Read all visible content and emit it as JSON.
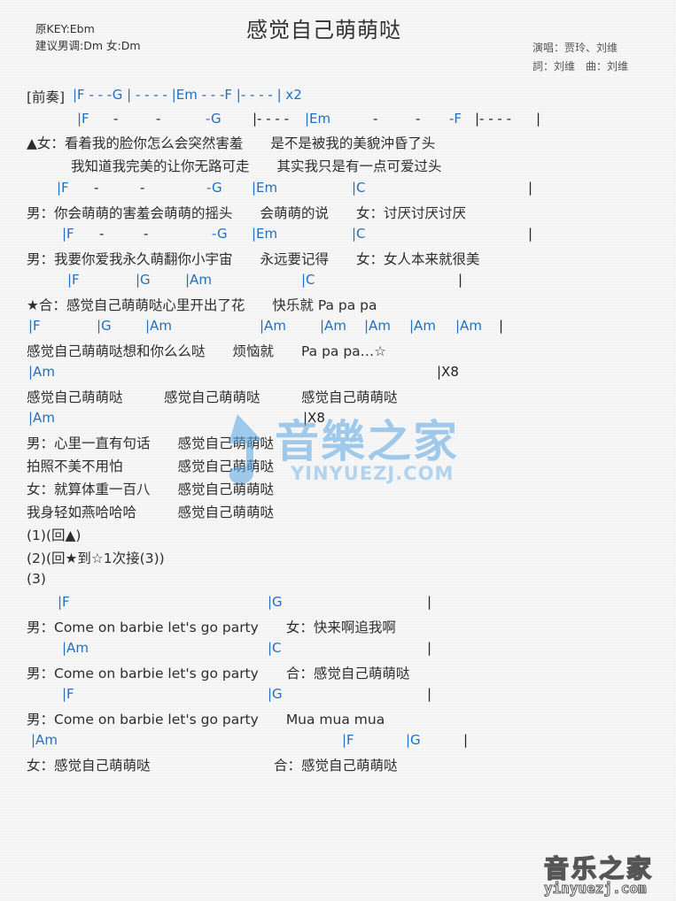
{
  "header": {
    "key": "原KEY:Ebm",
    "suggest": "建议男调:Dm 女:Dm",
    "title": "感觉自己萌萌哒",
    "singers": "演唱：贾玲、刘维",
    "credits": "詞：刘维　曲：刘维"
  },
  "intro": {
    "label": "[前奏]",
    "row1": "|F - -  -G | - - - - |Em - -  -F |- - - - | x2",
    "row2": [
      {
        "t": "|F",
        "c": 1
      },
      {
        "t": "-",
        "c": 0
      },
      {
        "t": "-",
        "c": 0
      },
      {
        "t": "-G",
        "c": 1
      },
      {
        "t": "|- - - -",
        "c": 0
      },
      {
        "t": "|Em",
        "c": 1
      },
      {
        "t": "-",
        "c": 0
      },
      {
        "t": "-",
        "c": 0
      },
      {
        "t": "-F",
        "c": 1
      },
      {
        "t": "|- - - -",
        "c": 0
      },
      {
        "t": "|",
        "c": 0
      }
    ]
  },
  "lines": [
    {
      "type": "lyric",
      "text": "▲女：看着我的脸你怎么会突然害羞　　是不是被我的美貌沖昏了头"
    },
    {
      "type": "lyric",
      "text": "我知道我完美的让你无路可走　　其实我只是有一点可爱过头"
    },
    {
      "type": "chord",
      "items": [
        "|F",
        "-",
        "-",
        "-G",
        "|Em",
        "|C",
        "|"
      ]
    },
    {
      "type": "lyric",
      "text": "男：你会萌萌的害羞会萌萌的摇头　　会萌萌的说　　女：讨厌讨厌讨厌"
    },
    {
      "type": "chord",
      "items": [
        "|F",
        "-",
        "-",
        "-G",
        "|Em",
        "|C",
        "|"
      ]
    },
    {
      "type": "lyric",
      "text": "男：我要你爱我永久萌翻你小宇宙　　永远要记得　　女：女人本来就很美"
    },
    {
      "type": "chord",
      "items": [
        "|F",
        "|G",
        "|Am",
        "|C",
        "|"
      ]
    },
    {
      "type": "lyric",
      "text": "★合：感觉自己萌萌哒心里开出了花　　快乐就  Pa pa pa"
    },
    {
      "type": "chord",
      "items": [
        "|F",
        "|G",
        "|Am",
        "|Am",
        "|Am",
        "|Am",
        "|Am",
        "|Am",
        "|"
      ]
    },
    {
      "type": "lyric",
      "text": "感觉自己萌萌哒想和你么么哒　　烦恼就　　Pa pa pa…☆"
    },
    {
      "type": "chord",
      "items": [
        "|Am",
        "|X8"
      ]
    },
    {
      "type": "lyric",
      "text": "感觉自己萌萌哒　　　感觉自己萌萌哒　　　感觉自己萌萌哒"
    },
    {
      "type": "chord",
      "items": [
        "|Am",
        "|X8"
      ]
    },
    {
      "type": "lyric",
      "text": "男：心里一直有句话　　感觉自己萌萌哒"
    },
    {
      "type": "lyric",
      "text": "拍照不美不用怕　　　　感觉自己萌萌哒"
    },
    {
      "type": "lyric",
      "text": "女：就算体重一百八　　感觉自己萌萌哒"
    },
    {
      "type": "lyric",
      "text": "我身轻如燕哈哈哈　　　感觉自己萌萌哒"
    },
    {
      "type": "lyric",
      "text": "(1)(回▲)"
    },
    {
      "type": "lyric",
      "text": "(2)(回★到☆1次接(3))"
    },
    {
      "type": "lyric",
      "text": "(3)"
    },
    {
      "type": "chord",
      "items": [
        "|F",
        "|G",
        "|"
      ]
    },
    {
      "type": "lyric",
      "text": "男：Come on barbie let's go party　　女：快来啊追我啊"
    },
    {
      "type": "chord",
      "items": [
        "|Am",
        "|C",
        "|"
      ]
    },
    {
      "type": "lyric",
      "text": "男：Come on barbie let's go party　　合：感觉自己萌萌哒"
    },
    {
      "type": "chord",
      "items": [
        "|F",
        "|G",
        "|"
      ]
    },
    {
      "type": "lyric",
      "text": "男：Come on barbie let's go party　　Mua mua mua"
    },
    {
      "type": "chord",
      "items": [
        "|Am",
        "|F",
        "|G",
        "|"
      ]
    },
    {
      "type": "lyric",
      "text": "女：感觉自己萌萌哒　　　　　　　　　合：感觉自己萌萌哒"
    }
  ],
  "watermark": {
    "brand": "音樂之家",
    "url": "YINYUEZJ.COM",
    "footer_brand": "音乐之家",
    "footer_url": "yinyuezj.com"
  },
  "colors": {
    "chord": "#1f6fc2",
    "text": "#2d2d2d",
    "watermark": "#5aa6e3"
  }
}
